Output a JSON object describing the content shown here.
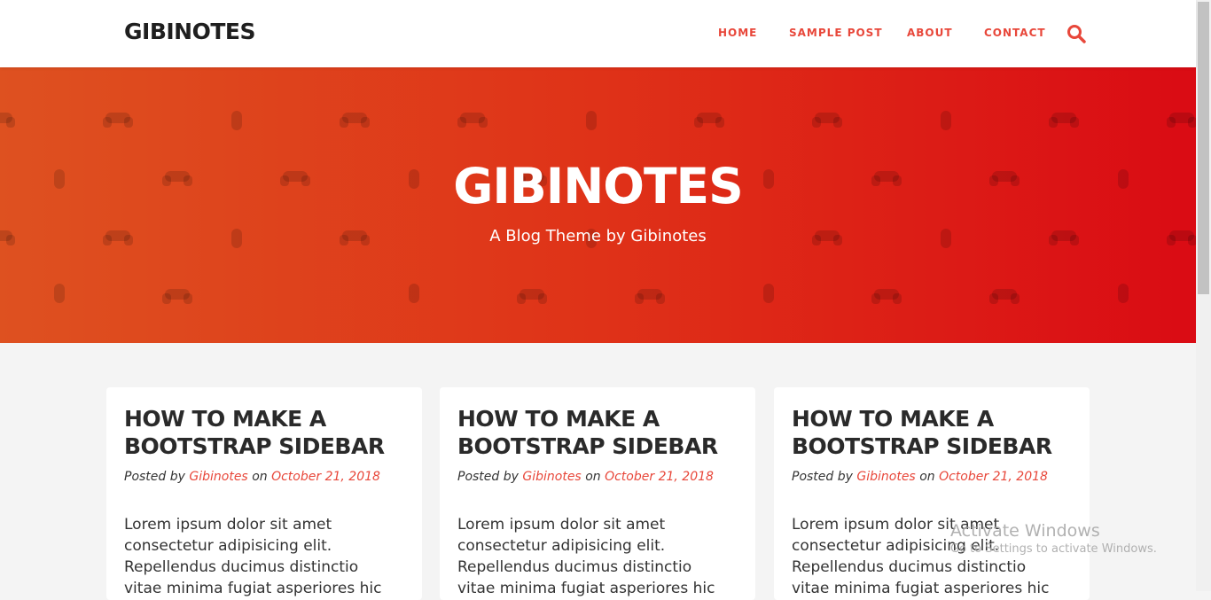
{
  "navbar": {
    "brand": "GIBINOTES",
    "items": [
      {
        "label": "HOME"
      },
      {
        "label": "SAMPLE POST"
      },
      {
        "label": "ABOUT"
      },
      {
        "label": "CONTACT"
      }
    ],
    "search_icon": "search-icon"
  },
  "hero": {
    "title": "GIBINOTES",
    "subtitle": "A Blog Theme by Gibinotes",
    "pattern_icons": [
      "gamepad-icon",
      "mouse-icon"
    ]
  },
  "posts": [
    {
      "title": "HOW TO MAKE A BOOTSTRAP SIDEBAR",
      "posted_by": "Posted by",
      "author": "Gibinotes",
      "on": "on",
      "date": "October 21, 2018",
      "excerpt": "Lorem ipsum dolor sit amet consectetur adipisicing elit. Repellendus ducimus distinctio vitae minima fugiat asperiores hic"
    },
    {
      "title": "HOW TO MAKE A BOOTSTRAP SIDEBAR",
      "posted_by": "Posted by",
      "author": "Gibinotes",
      "on": "on",
      "date": "October 21, 2018",
      "excerpt": "Lorem ipsum dolor sit amet consectetur adipisicing elit. Repellendus ducimus distinctio vitae minima fugiat asperiores hic"
    },
    {
      "title": "HOW TO MAKE A BOOTSTRAP SIDEBAR",
      "posted_by": "Posted by",
      "author": "Gibinotes",
      "on": "on",
      "date": "October 21, 2018",
      "excerpt": "Lorem ipsum dolor sit amet consectetur adipisicing elit. Repellendus ducimus distinctio vitae minima fugiat asperiores hic"
    }
  ],
  "watermark": {
    "title": "Activate Windows",
    "subtitle": "Go to Settings to activate Windows."
  },
  "colors": {
    "accent": "#e8473a",
    "hero_gradient_start": "#de5120",
    "hero_gradient_end": "#da0b14",
    "page_background": "#f4f4f4",
    "brand_text": "#1f1f1f"
  }
}
